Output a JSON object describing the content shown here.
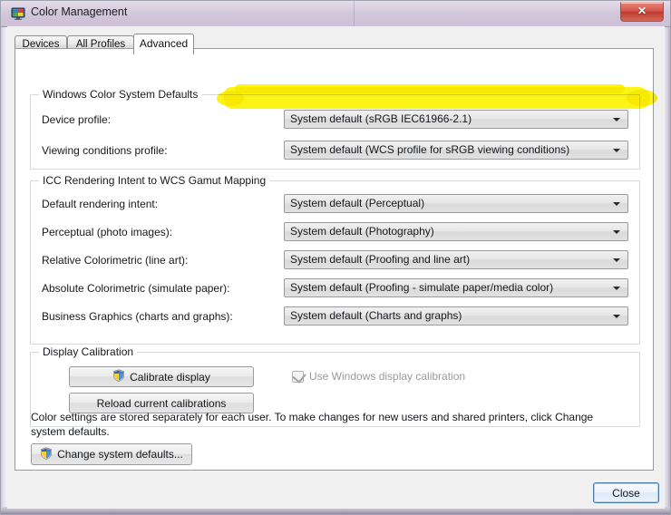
{
  "window": {
    "title": "Color Management",
    "icon": "color-management-monitor-icon",
    "close_label": "✕"
  },
  "tabs": [
    {
      "label": "Devices",
      "active": false
    },
    {
      "label": "All Profiles",
      "active": false
    },
    {
      "label": "Advanced",
      "active": true
    }
  ],
  "groups": {
    "wcs_defaults": {
      "title": "Windows Color System Defaults",
      "rows": [
        {
          "label": "Device profile:",
          "value": "System default (sRGB IEC61966-2.1)",
          "highlighted": true
        },
        {
          "label": "Viewing conditions profile:",
          "value": "System default (WCS profile for sRGB viewing conditions)",
          "highlighted": false
        }
      ]
    },
    "icc_rendering": {
      "title": "ICC Rendering Intent to WCS Gamut Mapping",
      "rows": [
        {
          "label": "Default rendering intent:",
          "value": "System default (Perceptual)"
        },
        {
          "label": "Perceptual (photo images):",
          "value": "System default (Photography)"
        },
        {
          "label": "Relative Colorimetric (line art):",
          "value": "System default (Proofing and line art)"
        },
        {
          "label": "Absolute Colorimetric (simulate paper):",
          "value": "System default (Proofing - simulate paper/media color)"
        },
        {
          "label": "Business Graphics (charts and graphs):",
          "value": "System default (Charts and graphs)"
        }
      ]
    },
    "display_calibration": {
      "title": "Display Calibration",
      "calibrate_button": "Calibrate display",
      "reload_button": "Reload current calibrations",
      "checkbox_label": "Use Windows display calibration",
      "checkbox_checked": true,
      "checkbox_disabled": true
    }
  },
  "footer": {
    "description": "Color settings are stored separately for each user. To make changes for new users and shared printers, click Change system defaults.",
    "change_defaults_button": "Change system defaults...",
    "close_button": "Close"
  },
  "colors": {
    "titlebar": "#d2c5da",
    "highlight": "#fbf400",
    "close_button": "#c8443a",
    "panel_background": "#ffffff",
    "dialog_background": "#f0f0f0"
  }
}
